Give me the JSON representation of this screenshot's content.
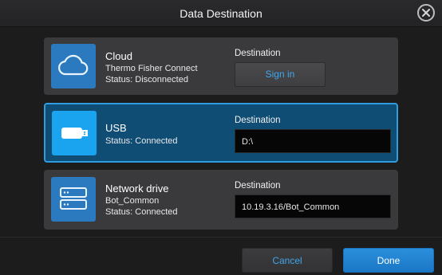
{
  "dialog": {
    "title": "Data Destination"
  },
  "destinations": [
    {
      "name": "Cloud",
      "subtitle": "Thermo Fisher Connect",
      "status": "Status: Disconnected",
      "destination_label": "Destination",
      "action_label": "Sign in",
      "icon": "cloud-icon",
      "selected": false
    },
    {
      "name": "USB",
      "status": "Status: Connected",
      "destination_label": "Destination",
      "destination_value": "D:\\",
      "icon": "usb-icon",
      "selected": true
    },
    {
      "name": "Network drive",
      "subtitle": "Bot_Common",
      "status": "Status: Connected",
      "destination_label": "Destination",
      "destination_value": "10.19.3.16/Bot_Common",
      "icon": "network-drive-icon",
      "selected": false
    }
  ],
  "footer": {
    "cancel_label": "Cancel",
    "done_label": "Done"
  },
  "colors": {
    "accent": "#2f9de0",
    "selected_card": "#0f4d74",
    "link_text": "#3fa6ee",
    "primary_button": "#1a77c6"
  }
}
